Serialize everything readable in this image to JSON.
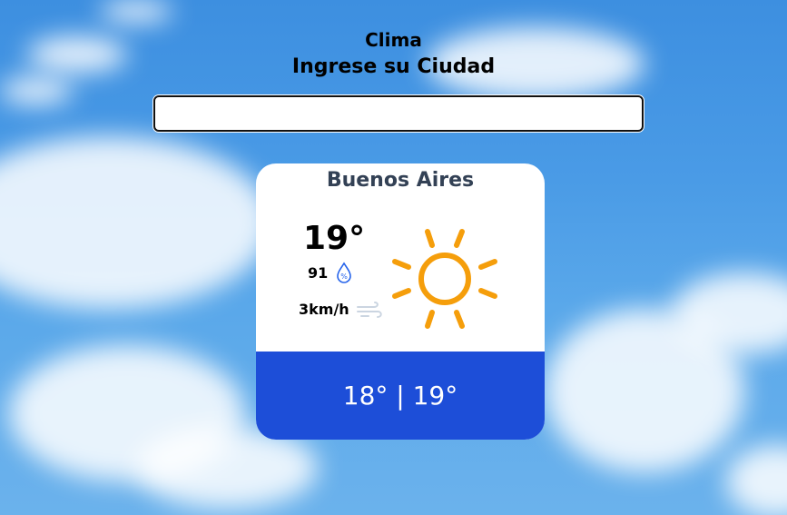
{
  "header": {
    "title": "Clima",
    "subtitle": "Ingrese su Ciudad"
  },
  "search": {
    "value": "",
    "placeholder": ""
  },
  "weather": {
    "city": "Buenos Aires",
    "temperature": "19°",
    "humidity": "91",
    "wind": "3km/h",
    "range": "18° | 19°",
    "condition_icon": "sun-icon",
    "humidity_icon": "humidity-drop-icon",
    "wind_icon": "wind-icon"
  },
  "colors": {
    "accent": "#1d4ed8",
    "sun": "#f59e0b",
    "city_text": "#334155"
  }
}
